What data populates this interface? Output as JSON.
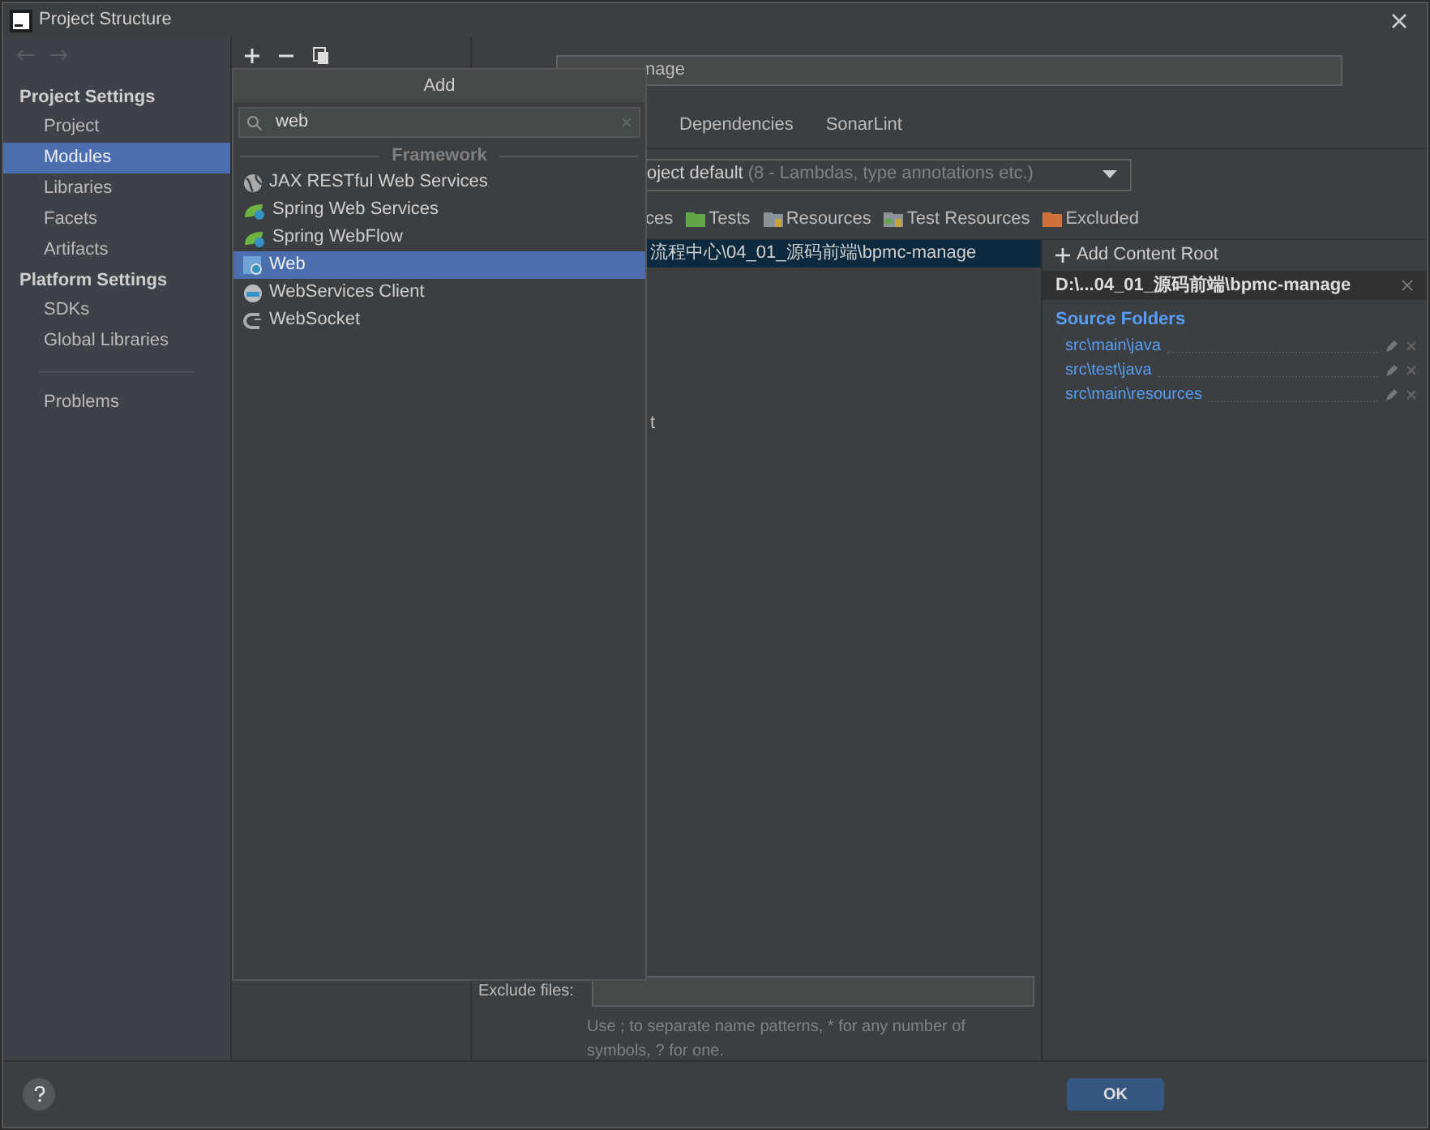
{
  "window": {
    "title": "Project Structure"
  },
  "sidebar": {
    "sections": [
      {
        "title": "Project Settings",
        "items": [
          {
            "label": "Project",
            "selected": false
          },
          {
            "label": "Modules",
            "selected": true
          },
          {
            "label": "Libraries",
            "selected": false
          },
          {
            "label": "Facets",
            "selected": false
          },
          {
            "label": "Artifacts",
            "selected": false
          }
        ]
      },
      {
        "title": "Platform Settings",
        "items": [
          {
            "label": "SDKs",
            "selected": false
          },
          {
            "label": "Global Libraries",
            "selected": false
          }
        ]
      }
    ],
    "extra_items": [
      {
        "label": "Problems",
        "selected": false
      }
    ]
  },
  "name_field": {
    "value": "nage"
  },
  "tabs": [
    {
      "label": "Dependencies"
    },
    {
      "label": "SonarLint"
    }
  ],
  "language_level": {
    "value": "oject default",
    "hint": "(8 - Lambdas, type annotations etc.)"
  },
  "mark_as": [
    {
      "label": "ces",
      "kind": "sources"
    },
    {
      "label": "Tests",
      "kind": "tests"
    },
    {
      "label": "Resources",
      "kind": "resources"
    },
    {
      "label": "Test Resources",
      "kind": "test_resources"
    },
    {
      "label": "Excluded",
      "kind": "excluded"
    }
  ],
  "tree": {
    "row": "流程中心\\04_01_源码前端\\bpmc-manage",
    "fragment": "t"
  },
  "content_root": {
    "add_label": "Add Content Root",
    "path": "D:\\...04_01_源码前端\\bpmc-manage",
    "section": "Source Folders",
    "folders": [
      "src\\main\\java",
      "src\\test\\java",
      "src\\main\\resources"
    ]
  },
  "exclude": {
    "label": "Exclude files:",
    "hint": "Use ; to separate name patterns, * for any number of symbols, ? for one."
  },
  "buttons": [
    {
      "label": "OK",
      "default": true
    }
  ],
  "popup": {
    "title": "Add",
    "search": "web",
    "group": "Framework",
    "items": [
      {
        "label": "JAX RESTful Web Services",
        "kind": "globe",
        "selected": false
      },
      {
        "label": "Spring Web Services",
        "kind": "spring",
        "selected": false
      },
      {
        "label": "Spring WebFlow",
        "kind": "spring",
        "selected": false
      },
      {
        "label": "Web",
        "kind": "web",
        "selected": true
      },
      {
        "label": "WebServices Client",
        "kind": "client",
        "selected": false
      },
      {
        "label": "WebSocket",
        "kind": "socket",
        "selected": false
      }
    ]
  }
}
